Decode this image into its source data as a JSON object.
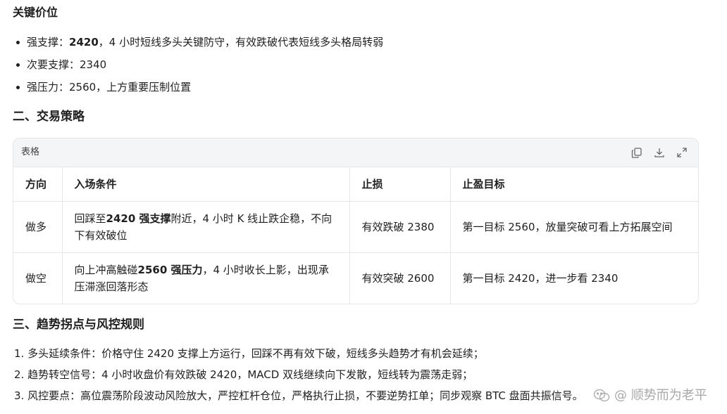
{
  "section1": {
    "title": "关键价位",
    "items": [
      {
        "prefix": "强支撑：",
        "bold": "2420",
        "suffix": "，4 小时短线多头关键防守，有效跌破代表短线多头格局转弱"
      },
      {
        "prefix": "次要支撑：2340",
        "bold": "",
        "suffix": ""
      },
      {
        "prefix": "强压力：2560，上方重要压制位置",
        "bold": "",
        "suffix": ""
      }
    ]
  },
  "section2": {
    "title": "二、交易策略"
  },
  "table": {
    "label": "表格",
    "tools": [
      "copy-icon",
      "download-icon",
      "expand-icon"
    ],
    "headers": [
      "方向",
      "入场条件",
      "止损",
      "止盈目标"
    ],
    "rows": [
      {
        "direction": "做多",
        "entry_prefix": "回踩至",
        "entry_bold": "2420 强支撑",
        "entry_suffix": "附近，4 小时 K 线止跌企稳，不向下有效破位",
        "stop": "有效跌破 2380",
        "target": "第一目标 2560，放量突破可看上方拓展空间"
      },
      {
        "direction": "做空",
        "entry_prefix": "向上冲高触碰",
        "entry_bold": "2560 强压力",
        "entry_suffix": "，4 小时收长上影，出现承压滞涨回落形态",
        "stop": "有效突破 2600",
        "target": "第一目标 2420，进一步看 2340"
      }
    ]
  },
  "section3": {
    "title": "三、趋势拐点与风控规则",
    "items": [
      "1. 多头延续条件：价格守住 2420 支撑上方运行，回踩不再有效下破，短线多头趋势才有机会延续；",
      "2. 趋势转空信号：4 小时收盘价有效跌破 2420，MACD 双线继续向下发散，短线转为震荡走弱；",
      "3. 风控要点：高位震荡阶段波动风险放大，严控杠杆仓位，严格执行止损，不要逆势扛单；同步观察 BTC 盘面共振信号。"
    ]
  },
  "watermark": {
    "text": "@ 顺势而为老平"
  }
}
